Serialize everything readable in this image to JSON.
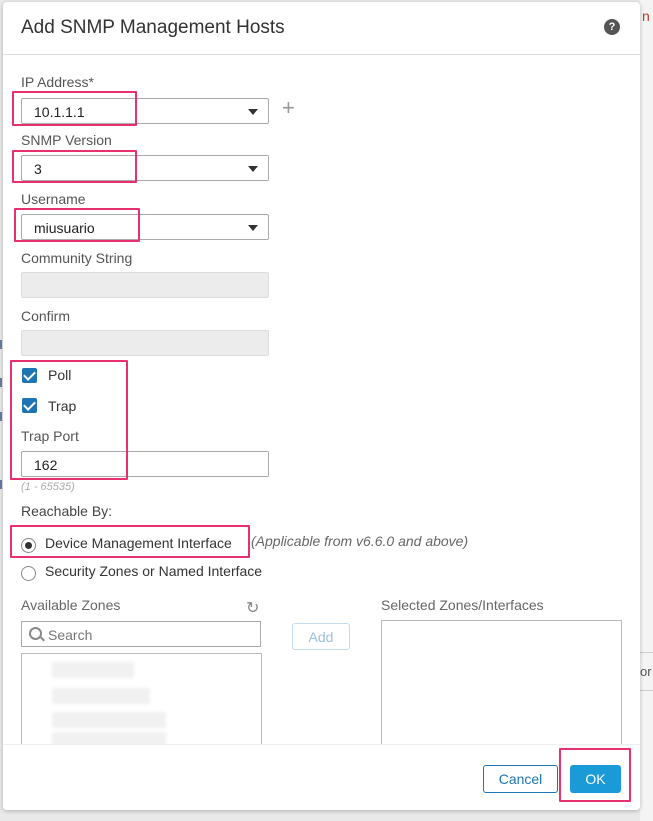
{
  "background": {
    "partial_text": "n h",
    "partial_right_text": "or"
  },
  "dialog": {
    "title": "Add SNMP Management Hosts",
    "help_icon": "?",
    "ip_address": {
      "label": "IP Address*",
      "value": "10.1.1.1"
    },
    "snmp_version": {
      "label": "SNMP Version",
      "value": "3"
    },
    "username": {
      "label": "Username",
      "value": "miusuario"
    },
    "community_string": {
      "label": "Community String",
      "value": ""
    },
    "confirm": {
      "label": "Confirm",
      "value": ""
    },
    "poll": {
      "label": "Poll",
      "checked": true
    },
    "trap": {
      "label": "Trap",
      "checked": true
    },
    "trap_port": {
      "label": "Trap Port",
      "value": "162",
      "hint": "(1 - 65535)"
    },
    "reachable_by": {
      "label": "Reachable By:",
      "options": [
        {
          "label": "Device Management Interface",
          "selected": true,
          "note": "(Applicable from v6.6.0 and above)"
        },
        {
          "label": "Security Zones or Named Interface",
          "selected": false
        }
      ]
    },
    "available_zones": {
      "label": "Available Zones",
      "search_placeholder": "Search"
    },
    "add_button": "Add",
    "selected_zones": {
      "label": "Selected Zones/Interfaces"
    },
    "cancel_button": "Cancel",
    "ok_button": "OK"
  },
  "colors": {
    "accent": "#1d75b3",
    "primary_button": "#1a9ad6",
    "highlight": "#e8306e"
  },
  "icons": {
    "plus": "plus-icon",
    "caret": "chevron-down-icon",
    "refresh": "refresh-icon",
    "search": "search-icon"
  }
}
